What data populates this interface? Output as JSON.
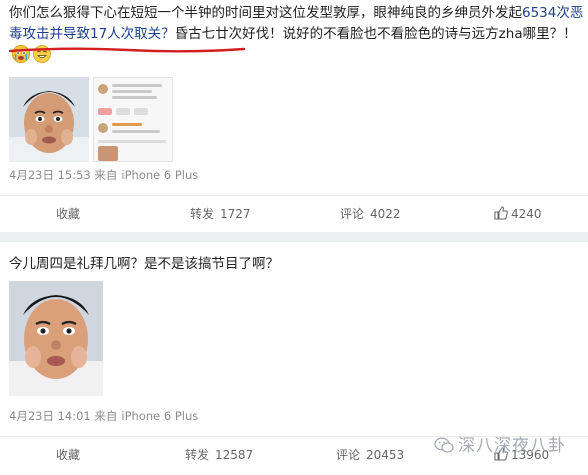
{
  "post1": {
    "text_before": "你们怎么狠得下心在短短一个半钟的时间里对这位发型敦厚，眼神纯良的乡绅员外发起",
    "text_highlight": "6534次恶毒攻击并导致17人次取关？",
    "text_after": "昏古七廿次好伐！说好的不看脸也不看脸色的诗与远方zha哪里？！",
    "timestamp": "4月23日 15:53 来自",
    "device": "iPhone 6 Plus",
    "actions": {
      "favorite": "收藏",
      "repost": "转发",
      "repost_count": "1727",
      "comment": "评论",
      "comment_count": "4022",
      "like_count": "4240"
    },
    "emojis": [
      "crying-face",
      "grinning-face"
    ]
  },
  "post2": {
    "text": "今儿周四是礼拜几啊？是不是该搞节目了啊？",
    "timestamp": "4月23日 14:01 来自",
    "device": "iPhone 6 Plus",
    "actions": {
      "favorite": "收藏",
      "repost": "转发",
      "repost_count": "12587",
      "comment": "评论",
      "comment_count": "20453",
      "like_count": "13960"
    }
  },
  "watermark": "深八深夜八卦",
  "colors": {
    "highlight_text": "#1d3f8a",
    "underline": "#d22020",
    "meta_gray": "#8c8c8c",
    "separator": "#eceff2"
  }
}
